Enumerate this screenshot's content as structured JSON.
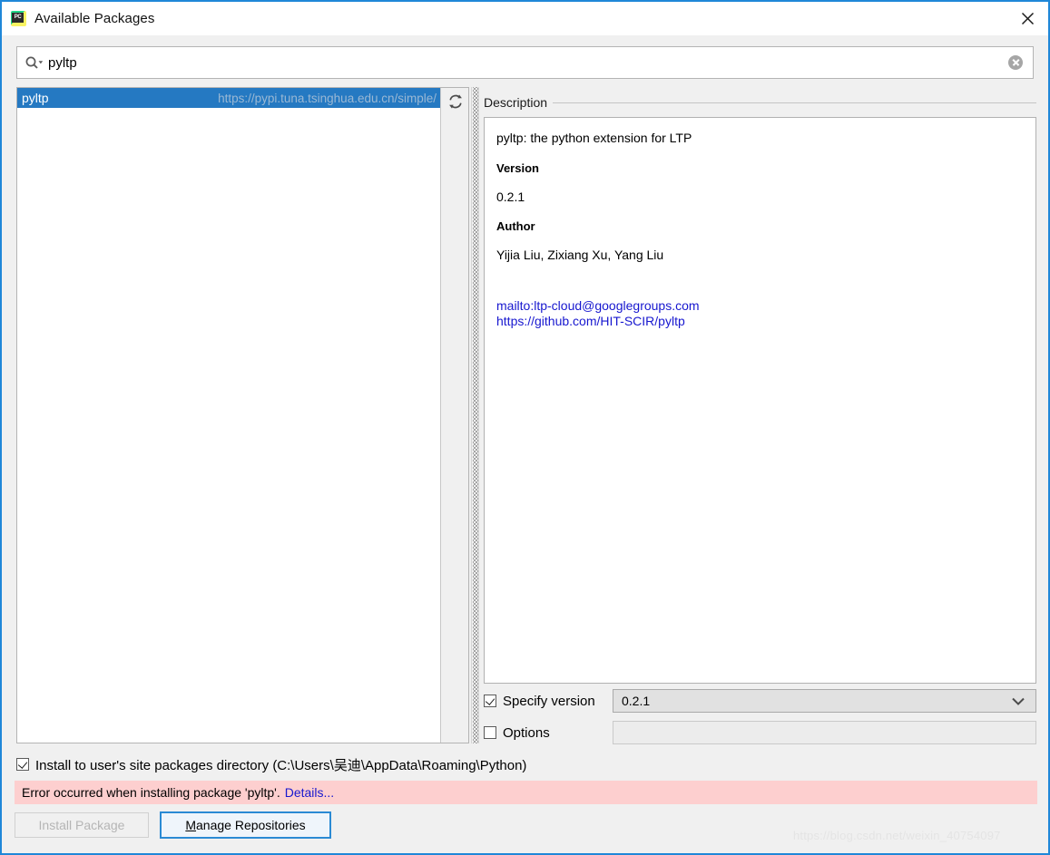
{
  "window": {
    "title": "Available Packages",
    "app_icon": "pycharm-icon",
    "close_icon": "close-icon",
    "border_color": "#1f87d8"
  },
  "search": {
    "icon": "search-icon",
    "value": "pyltp",
    "placeholder": "",
    "clear_icon": "clear-icon"
  },
  "package_list": {
    "refresh_icon": "refresh-icon",
    "items": [
      {
        "name": "pyltp",
        "repository_url": "https://pypi.tuna.tsinghua.edu.cn/simple/",
        "selected": true,
        "selection_color": "#2579c2"
      }
    ]
  },
  "description": {
    "title": "Description",
    "summary": "pyltp: the python extension for LTP",
    "fields": [
      {
        "label": "Version",
        "value": "0.2.1"
      },
      {
        "label": "Author",
        "value": "Yijia Liu, Zixiang Xu, Yang Liu"
      }
    ],
    "links": [
      "mailto:ltp-cloud@googlegroups.com",
      "https://github.com/HIT-SCIR/pyltp"
    ],
    "link_color": "#1717cf"
  },
  "options_panel": {
    "specify_version": {
      "label": "Specify version",
      "checked": true,
      "selected_value": "0.2.1",
      "arrow_icon": "chevron-down-icon"
    },
    "options": {
      "label": "Options",
      "checked": false,
      "value": "",
      "enabled": false
    }
  },
  "install_to_user": {
    "label": "Install to user's site packages directory (C:\\Users\\吴迪\\AppData\\Roaming\\Python)",
    "checked": true
  },
  "status": {
    "error_message": "Error occurred when installing package 'pyltp'.",
    "details_label": "Details...",
    "background_color": "#fdcfcf"
  },
  "buttons": {
    "install": {
      "label": "Install Package",
      "enabled": false
    },
    "manage": {
      "label_before": "",
      "mnemonic": "M",
      "label_after": "anage Repositories",
      "focused": true
    }
  },
  "watermark": "https://blog.csdn.net/weixin_40754097"
}
